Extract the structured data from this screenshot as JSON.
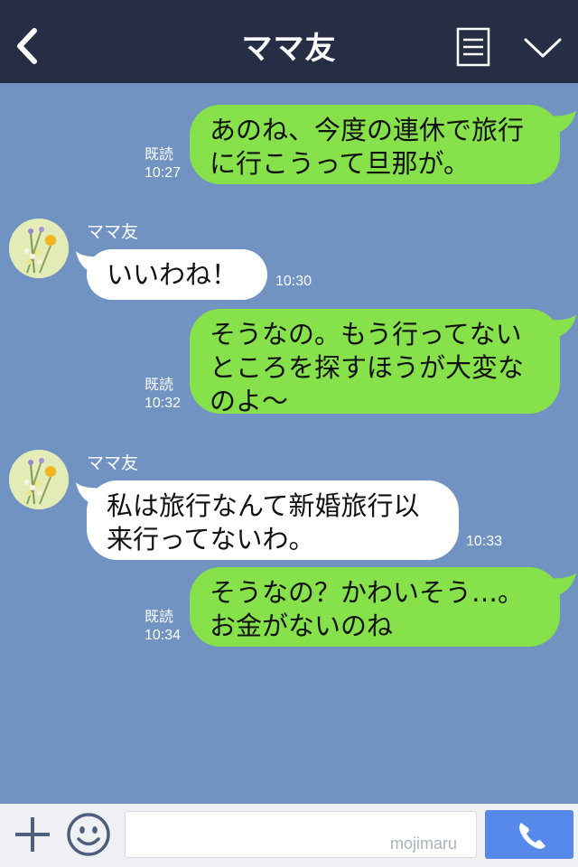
{
  "header": {
    "title": "ママ友"
  },
  "messages": [
    {
      "lines": [
        "あのね、今度の連休で旅行",
        "に行こうって旦那が。"
      ],
      "read": "既読",
      "time": "10:27"
    },
    {
      "sender": "ママ友",
      "lines": [
        "いいわね！"
      ],
      "time": "10:30"
    },
    {
      "lines": [
        "そうなの。もう行ってない",
        "ところを探すほうが大変な",
        "のよ〜"
      ],
      "read": "既読",
      "time": "10:32"
    },
    {
      "sender": "ママ友",
      "lines": [
        "私は旅行なんて新婚旅行以",
        "来行ってないわ。"
      ],
      "time": "10:33"
    },
    {
      "lines": [
        "そうなの？かわいそう…。",
        "お金がないのね"
      ],
      "read": "既読",
      "time": "10:34"
    }
  ],
  "input": {
    "value": "",
    "watermark": "mojimaru"
  },
  "colors": {
    "header_bg": "#252e45",
    "chat_bg": "#7193c1",
    "outgoing_bubble": "#86e14b",
    "incoming_bubble": "#ffffff",
    "call_button": "#5689ea"
  },
  "icons": {
    "back": "chevron-left-icon",
    "notes": "notes-icon",
    "more": "chevron-down-icon",
    "plus": "plus-icon",
    "emoji": "smiley-icon",
    "call": "phone-icon"
  }
}
